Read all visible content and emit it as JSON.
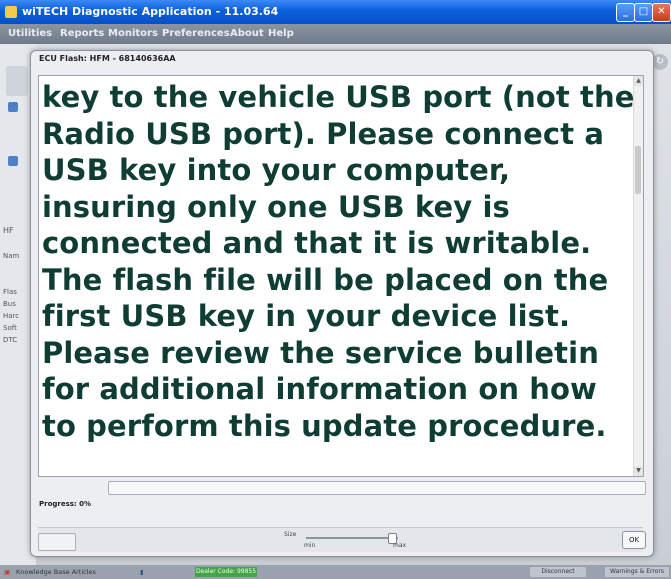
{
  "window": {
    "title": "wiTECH Diagnostic Application - 11.03.64"
  },
  "menu": {
    "items": [
      "Utilities",
      "Reports",
      "Monitors",
      "Preferences",
      "About",
      "Help"
    ]
  },
  "left_strip": {
    "labels": [
      "HF",
      "Nam",
      "Flas",
      "Bus",
      "Harc",
      "Soft",
      "DTC"
    ]
  },
  "dialog": {
    "title": "ECU Flash: HFM - 68140636AA",
    "message": "key to the vehicle USB port (not the Radio USB port). Please connect a USB key into your computer, insuring only one USB key is connected and that it is writable. The flash file will be placed on the first USB key in your device list. Please review the service bulletin for additional information on how to perform this update procedure.",
    "progress_label": "Progress: 0%",
    "progress_value": 0,
    "size_label": "Size",
    "min_label": "min",
    "max_label": "max",
    "ok_label": "OK"
  },
  "statusbar": {
    "knowledge": "Knowledge Base Articles",
    "code": "Dealer Code: 99855",
    "disconnect": "Disconnect",
    "warnings": "Warnings & Errors"
  },
  "colors": {
    "message_text": "#0f3d33",
    "titlebar": "#0a5fd8",
    "status_green": "#45a34a"
  }
}
